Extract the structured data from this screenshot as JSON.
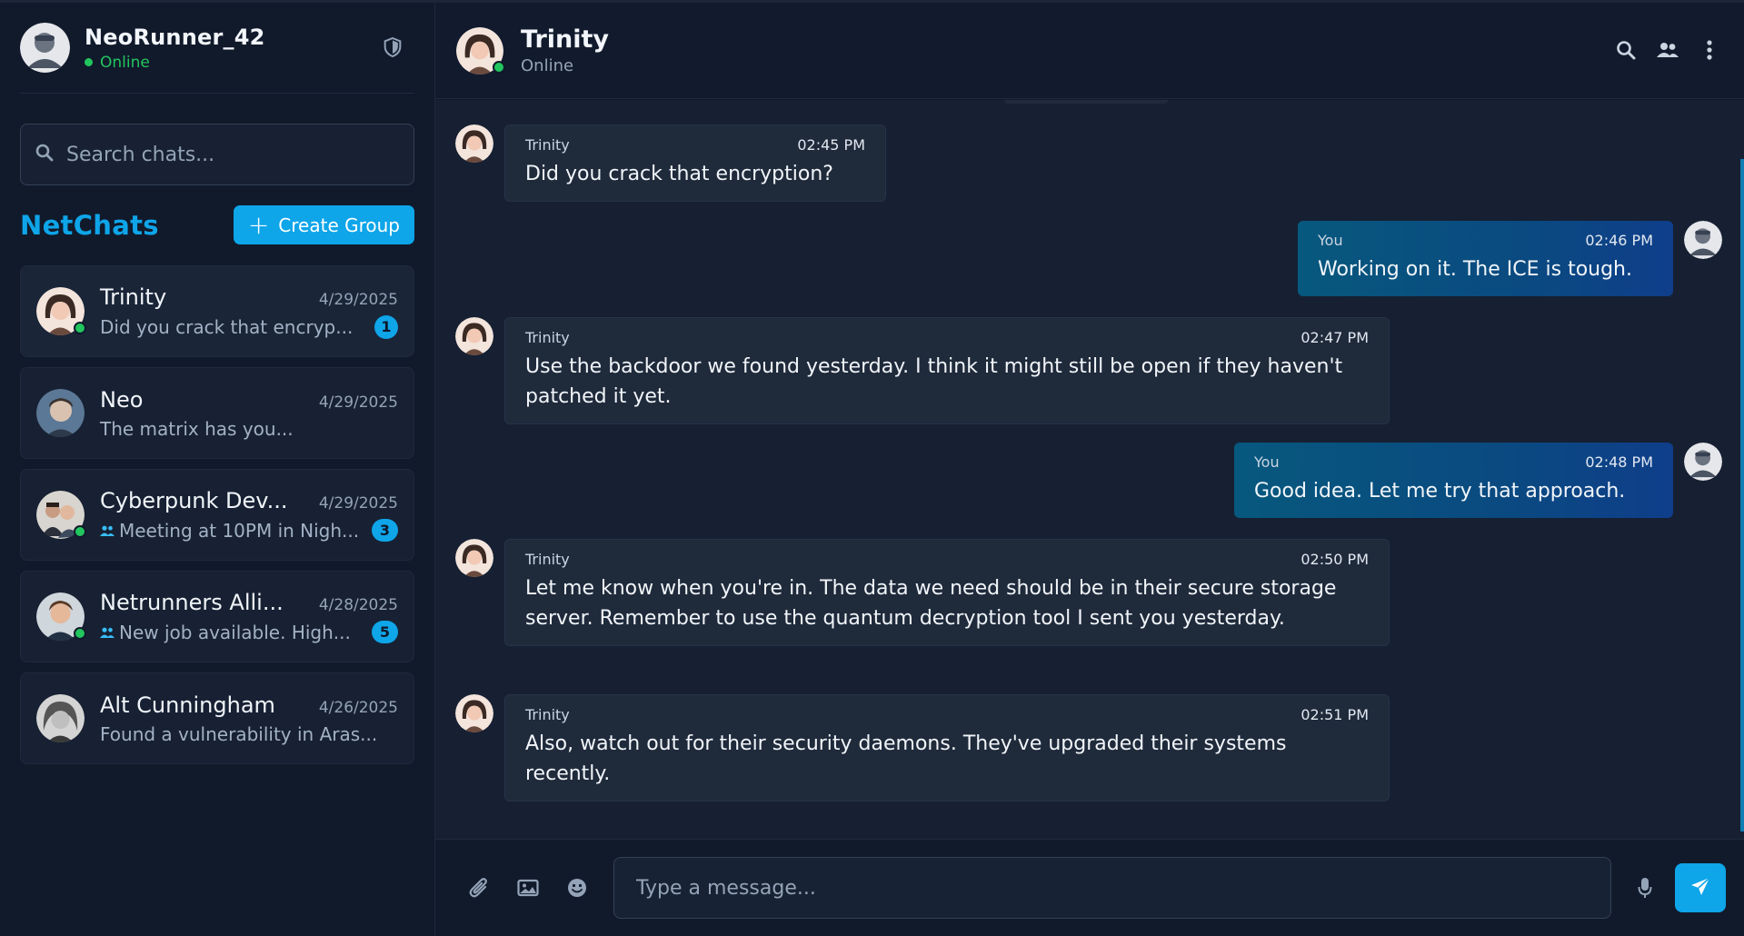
{
  "current_user": {
    "name": "NeoRunner_42",
    "status": "Online"
  },
  "search": {
    "placeholder": "Search chats..."
  },
  "sidebar": {
    "brand": "NetChats",
    "create_group_label": "Create Group",
    "chats": [
      {
        "name": "Trinity",
        "date": "4/29/2025",
        "preview": "Did you crack that encryp...",
        "badge": "1",
        "online": true,
        "group": false
      },
      {
        "name": "Neo",
        "date": "4/29/2025",
        "preview": "The matrix has you...",
        "badge": "",
        "online": false,
        "group": false
      },
      {
        "name": "Cyberpunk Dev...",
        "date": "4/29/2025",
        "preview": "Meeting at 10PM in Nigh...",
        "badge": "3",
        "online": true,
        "group": true
      },
      {
        "name": "Netrunners Alli...",
        "date": "4/28/2025",
        "preview": "New job available. High...",
        "badge": "5",
        "online": true,
        "group": true
      },
      {
        "name": "Alt Cunningham",
        "date": "4/26/2025",
        "preview": "Found a vulnerability in Aras...",
        "badge": "",
        "online": false,
        "group": false
      }
    ]
  },
  "conversation": {
    "name": "Trinity",
    "status": "Online",
    "messages": [
      {
        "sender": "Trinity",
        "time": "02:45 PM",
        "text": "Did you crack that encryption?"
      },
      {
        "sender": "You",
        "time": "02:46 PM",
        "text": "Working on it. The ICE is tough."
      },
      {
        "sender": "Trinity",
        "time": "02:47 PM",
        "text": "Use the backdoor we found yesterday. I think it might still be open if they haven't patched it yet."
      },
      {
        "sender": "You",
        "time": "02:48 PM",
        "text": "Good idea. Let me try that approach."
      },
      {
        "sender": "Trinity",
        "time": "02:50 PM",
        "text": "Let me know when you're in. The data we need should be in their secure storage server. Remember to use the quantum decryption tool I sent you yesterday."
      },
      {
        "sender": "Trinity",
        "time": "02:51 PM",
        "text": "Also, watch out for their security daemons. They've upgraded their systems recently."
      }
    ]
  },
  "composer": {
    "placeholder": "Type a message..."
  },
  "colors": {
    "accent": "#0ea5e9",
    "online": "#22c55e",
    "background": "#0f1729"
  }
}
